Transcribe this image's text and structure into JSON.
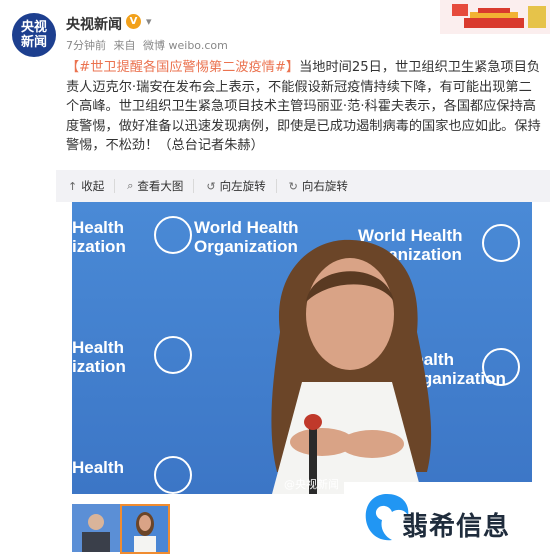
{
  "header": {
    "avatar_line1": "央视",
    "avatar_line2": "新闻",
    "user_name": "央视新闻",
    "time": "7分钟前",
    "source_prefix": "来自",
    "source": "微博 weibo.com"
  },
  "post": {
    "hashtag": "【#世卫提醒各国应警惕第二波疫情#】",
    "body": "当地时间25日，世卫组织卫生紧急项目负责人迈克尔·瑞安在发布会上表示，不能假设新冠疫情持续下降，有可能出现第二个高峰。世卫组织卫生紧急项目技术主管玛丽亚·范·科霍夫表示，各国都应保持高度警惕，做好准备以迅速发现病例，即使是已成功遏制病毒的国家也应如此。保持警惕，不松劲！（总台记者朱赫）"
  },
  "toolbar": {
    "collapse": "收起",
    "view_large": "查看大图",
    "rotate_left": "向左旋转",
    "rotate_right": "向右旋转"
  },
  "photo": {
    "who_line1": "World Health",
    "who_line2": "Organization",
    "who_left_line1": "Health",
    "who_left_line2": "ization",
    "watermark": "@央视新闻"
  },
  "brand": {
    "text": "翡希信息"
  },
  "colors": {
    "hashtag": "#eb7350",
    "who_blue": "#3c76c6",
    "avatar_bg": "#1d3f8f"
  }
}
